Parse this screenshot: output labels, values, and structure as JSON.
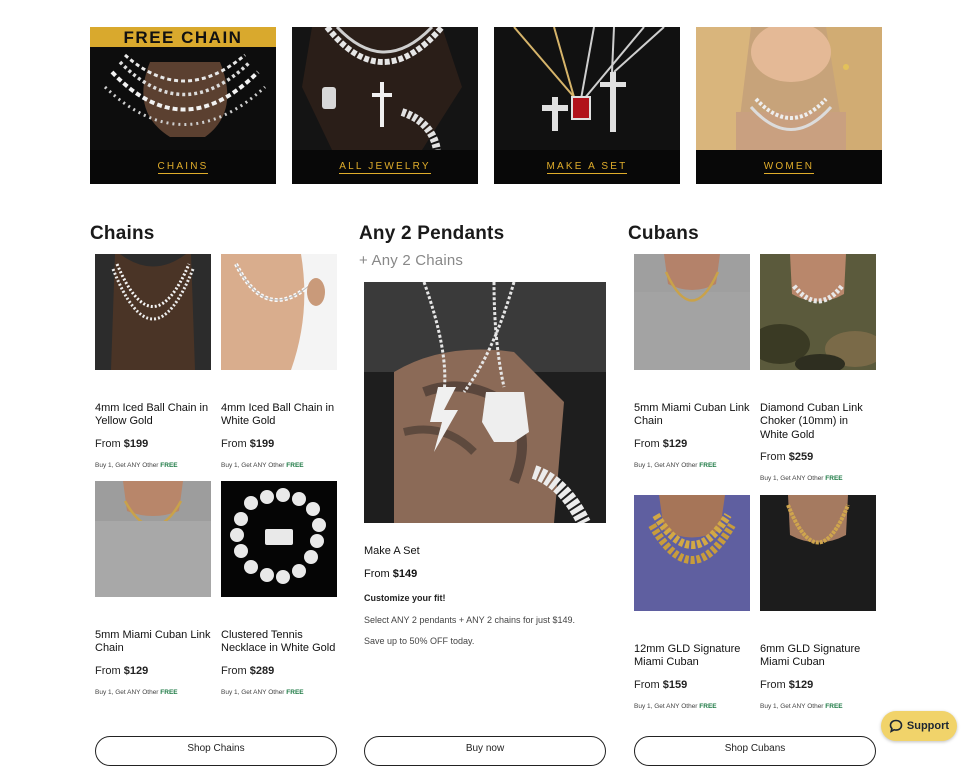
{
  "categories": [
    {
      "label": "CHAINS",
      "banner": "FREE CHAIN"
    },
    {
      "label": "ALL JEWELRY"
    },
    {
      "label": "MAKE A SET"
    },
    {
      "label": "WOMEN"
    }
  ],
  "chains": {
    "title": "Chains",
    "products": [
      {
        "name": "4mm Iced Ball Chain in Yellow Gold",
        "from": "From",
        "price": "$199",
        "promo": "Buy 1, Get ANY Other",
        "free": "FREE"
      },
      {
        "name": "4mm Iced Ball Chain in White Gold",
        "from": "From",
        "price": "$199",
        "promo": "Buy 1, Get ANY Other",
        "free": "FREE"
      },
      {
        "name": "5mm Miami Cuban Link Chain",
        "from": "From",
        "price": "$129",
        "promo": "Buy 1, Get ANY Other",
        "free": "FREE"
      },
      {
        "name": "Clustered Tennis Necklace in White Gold",
        "from": "From",
        "price": "$289",
        "promo": "Buy 1, Get ANY Other",
        "free": "FREE"
      }
    ],
    "button": "Shop Chains"
  },
  "pendants": {
    "title": "Any 2 Pendants",
    "subtitle": "+ Any 2 Chains",
    "feature_name": "Make A Set",
    "from": "From",
    "price": "$149",
    "tagline": "Customize your fit!",
    "desc1": "Select ANY 2 pendants + ANY 2 chains for just $149.",
    "desc2": "Save up to 50% OFF today.",
    "button": "Buy now"
  },
  "cubans": {
    "title": "Cubans",
    "products": [
      {
        "name": "5mm Miami Cuban Link Chain",
        "from": "From",
        "price": "$129",
        "promo": "Buy 1, Get ANY Other",
        "free": "FREE"
      },
      {
        "name": "Diamond Cuban Link Choker (10mm) in White Gold",
        "from": "From",
        "price": "$259",
        "promo": "Buy 1, Get ANY Other",
        "free": "FREE"
      },
      {
        "name": "12mm GLD Signature Miami Cuban",
        "from": "From",
        "price": "$159",
        "promo": "Buy 1, Get ANY Other",
        "free": "FREE"
      },
      {
        "name": "6mm GLD Signature Miami Cuban",
        "from": "From",
        "price": "$129",
        "promo": "Buy 1, Get ANY Other",
        "free": "FREE"
      }
    ],
    "button": "Shop Cubans"
  },
  "support": {
    "label": "Support",
    "icon": "chat-bubble-icon"
  },
  "colors": {
    "accent_gold": "#e0ad2b",
    "free_green": "#1d7a44",
    "support_bg": "#f1d36a"
  }
}
